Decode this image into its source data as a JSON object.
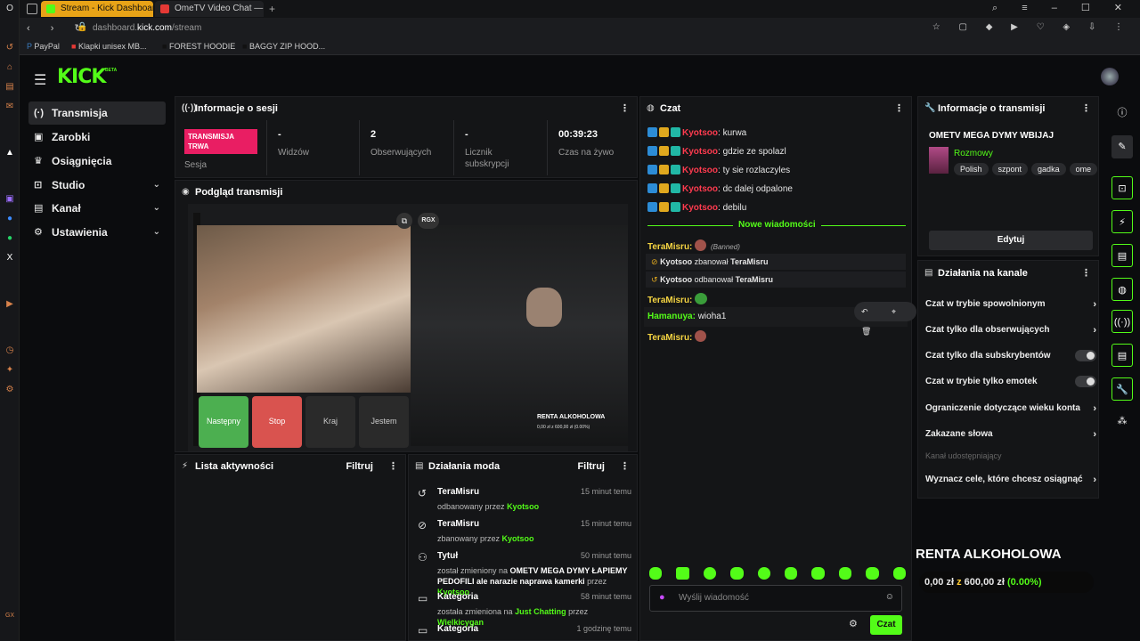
{
  "browser": {
    "tabs": [
      {
        "title": "Stream - Kick Dashboard",
        "active": true
      },
      {
        "title": "OmeTV Video Chat —",
        "active": false
      }
    ],
    "url": {
      "host_prefix": "dashboard.",
      "host": "kick.com",
      "path": "/stream"
    },
    "bookmarks": [
      "PayPal",
      "Klapki unisex MB...",
      "FOREST HOODIE",
      "BAGGY ZIP HOOD..."
    ],
    "gx_label": "GX"
  },
  "header": {
    "logo": "KICK",
    "logo_badge": "BETA"
  },
  "sidebar": {
    "items": [
      {
        "label": "Transmisja",
        "icon": "broadcast-icon",
        "active": true
      },
      {
        "label": "Zarobki",
        "icon": "wallet-icon"
      },
      {
        "label": "Osiągnięcia",
        "icon": "trophy-icon"
      },
      {
        "label": "Studio",
        "icon": "studio-icon",
        "expandable": true
      },
      {
        "label": "Kanał",
        "icon": "channel-icon",
        "expandable": true
      },
      {
        "label": "Ustawienia",
        "icon": "gear-icon",
        "expandable": true
      }
    ]
  },
  "session": {
    "title": "Informacje o sesji",
    "live_badge": "TRANSMISJA TRWA",
    "session_label": "Sesja",
    "stats": [
      {
        "value": "-",
        "label": "Widzów"
      },
      {
        "value": "2",
        "label": "Obserwujących"
      },
      {
        "value": "-",
        "label": "Licznik subskrypcji"
      },
      {
        "value": "00:39:23",
        "label": "Czas na żywo"
      }
    ]
  },
  "preview": {
    "title": "Podgląd transmisji",
    "buttons": {
      "next": "Następny",
      "stop": "Stop",
      "country": "Kraj",
      "gender": "Jestem"
    },
    "overlay": {
      "title": "RENTA ALKOHOLOWA",
      "amount": "0,00 zł z 600,00 zł (0.00%)"
    },
    "chip": "RGX"
  },
  "activity": {
    "title": "Lista aktywności",
    "filter": "Filtruj"
  },
  "mod_actions": {
    "title": "Działania moda",
    "filter": "Filtruj",
    "rows": [
      {
        "icon": "undo-icon",
        "title": "TeraMisru",
        "desc_pre": "odbanowany przez ",
        "desc_user": "Kyotsoo",
        "time": "15 minut temu"
      },
      {
        "icon": "ban-icon",
        "title": "TeraMisru",
        "desc_pre": "zbanowany przez ",
        "desc_user": "Kyotsoo",
        "time": "15 minut temu"
      },
      {
        "icon": "users-icon",
        "title": "Tytuł",
        "desc_pre": "został zmieniony na ",
        "desc_bold": "OMETV MEGA DYMY ŁAPIEMY PEDOFILI ale narazie naprawa kamerki",
        "desc_mid": " przez ",
        "desc_user": "Kyotsoo",
        "time": "50 minut temu"
      },
      {
        "icon": "category-icon",
        "title": "Kategoria",
        "desc_pre": "została zmieniona na ",
        "desc_bold": "Just Chatting",
        "desc_mid": " przez ",
        "desc_user": "Wielkicygan",
        "time": "58 minut temu"
      },
      {
        "icon": "category-icon",
        "title": "Kategoria",
        "desc_pre": "",
        "desc_user": "",
        "time": "1 godzinę temu"
      }
    ]
  },
  "chat": {
    "title": "Czat",
    "messages": [
      {
        "user": "Kyotsoo",
        "text": "kurwa"
      },
      {
        "user": "Kyotsoo",
        "text": "gdzie ze spolazl"
      },
      {
        "user": "Kyotsoo",
        "text": "ty sie rozlaczyles"
      },
      {
        "user": "Kyotsoo",
        "text": "dc dalej odpalone"
      },
      {
        "user": "Kyotsoo",
        "text": "debilu"
      }
    ],
    "new_messages": "Nowe wiadomości",
    "later": {
      "teramisru1": "TeraMisru:",
      "banned": "(Banned)",
      "ban_event": {
        "user": "Kyotsoo",
        "action": "zbanował",
        "target": "TeraMisru"
      },
      "unban_event": {
        "user": "Kyotsoo",
        "action": "odbanował",
        "target": "TeraMisru"
      },
      "teramisru2": "TeraMisru:",
      "hamanuya": "Hamanuya:",
      "hamanuya_text": "wioha1",
      "teramisru3": "TeraMisru:"
    },
    "input_placeholder": "Wyślij wiadomość",
    "send_label": "Czat"
  },
  "stream_info": {
    "title": "Informacje o transmisji",
    "stream_title": "OMETV MEGA DYMY WBIJAJ",
    "category": "Rozmowy",
    "tags": [
      "Polish",
      "szpont",
      "gadka",
      "ome"
    ],
    "edit": "Edytuj"
  },
  "channel_actions": {
    "title": "Działania na kanale",
    "rows": [
      {
        "label": "Czat w trybie spowolnionym",
        "control": "arrow"
      },
      {
        "label": "Czat tylko dla obserwujących",
        "control": "arrow"
      },
      {
        "label": "Czat tylko dla subskrybentów",
        "control": "toggle"
      },
      {
        "label": "Czat w trybie tylko emotek",
        "control": "toggle"
      },
      {
        "label": "Ograniczenie dotyczące wieku konta",
        "control": "arrow"
      },
      {
        "label": "Zakazane słowa",
        "control": "arrow"
      },
      {
        "label": "Kanał udostępniający",
        "control": "none"
      },
      {
        "label": "Wyznacz cele, które chcesz osiągnąć",
        "control": "arrow"
      }
    ]
  },
  "goal_overlay": {
    "title": "RENTA ALKOHOLOWA",
    "current": "0,00 zł",
    "word": "z",
    "target": "600,00 zł",
    "percent": "(0.00%)"
  },
  "colors": {
    "accent": "#53fc18",
    "live": "#e91e63",
    "stop": "#d9534f"
  }
}
